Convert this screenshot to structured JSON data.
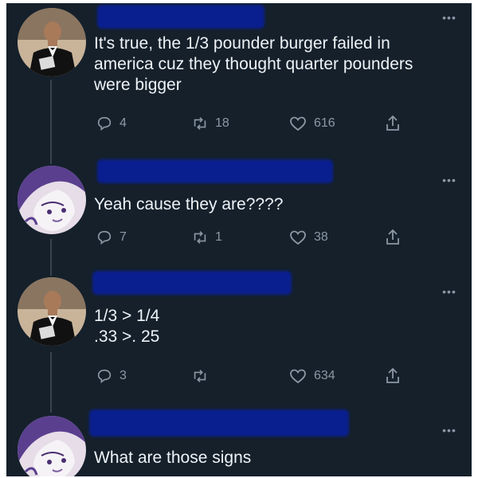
{
  "thread": [
    {
      "avatar": "man-in-tuxedo-avatar",
      "text": "It's true, the 1/3 pounder burger failed in america cuz they thought quarter pounders were bigger",
      "replies": "4",
      "retweets": "18",
      "likes": "616"
    },
    {
      "avatar": "anime-character-avatar",
      "text": "Yeah cause they are????",
      "replies": "7",
      "retweets": "1",
      "likes": "38"
    },
    {
      "avatar": "man-in-tuxedo-avatar",
      "text": "1/3 > 1/4\n.33 >. 25",
      "replies": "3",
      "retweets": "",
      "likes": "634"
    },
    {
      "avatar": "anime-character-avatar",
      "text": "What are those signs"
    }
  ],
  "icons": {
    "reply": "reply-icon",
    "retweet": "retweet-icon",
    "like": "heart-icon",
    "share": "share-icon",
    "more": "more-options-icon"
  },
  "colors": {
    "background": "#15202b",
    "text": "#eef3f7",
    "muted": "#8b98a5",
    "redaction": "#0a1f8f"
  }
}
